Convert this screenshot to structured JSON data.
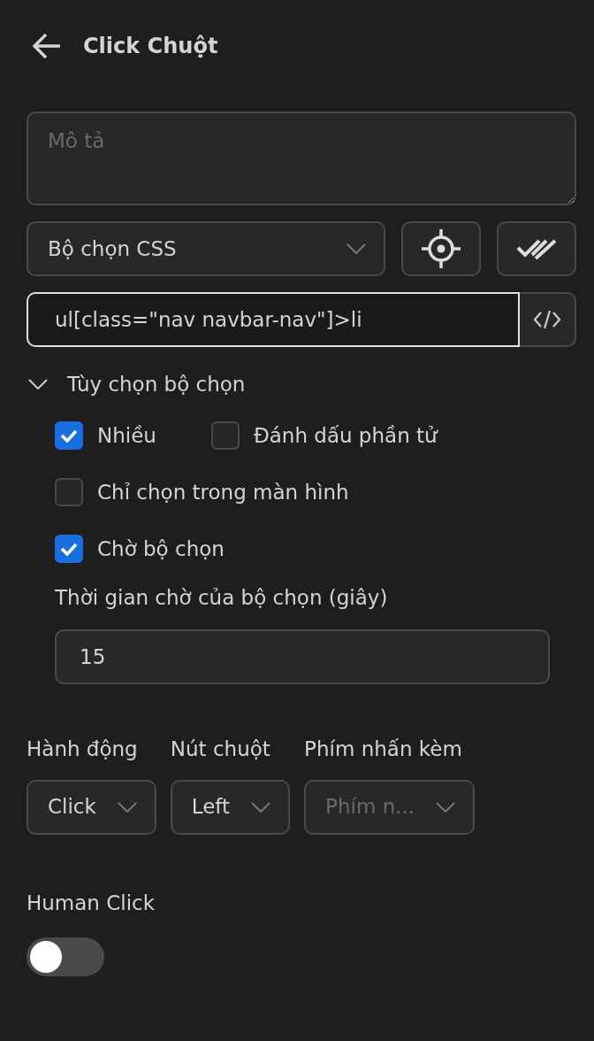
{
  "header": {
    "title": "Click Chuột"
  },
  "description": {
    "placeholder": "Mô tả"
  },
  "selector_type": {
    "value": "Bộ chọn CSS"
  },
  "selector": {
    "value": "ul[class=\"nav navbar-nav\"]>li"
  },
  "selector_options": {
    "label": "Tùy chọn bộ chọn",
    "expanded": true,
    "option_rows": [
      [
        {
          "label": "Nhiều",
          "checked": true
        },
        {
          "label": "Đánh dấu phần tử",
          "checked": false
        }
      ],
      [
        {
          "label": "Chỉ chọn trong màn hình",
          "checked": false
        }
      ],
      [
        {
          "label": "Chờ bộ chọn",
          "checked": true
        }
      ]
    ],
    "timeout": {
      "label": "Thời gian chờ của bộ chọn (giây)",
      "value": "15"
    }
  },
  "dropdowns": [
    {
      "label": "Hành động",
      "value": "Click"
    },
    {
      "label": "Nút chuột",
      "value": "Left"
    },
    {
      "label": "Phím nhấn kèm",
      "placeholder": "Phím n..."
    }
  ],
  "human_click": {
    "label": "Human Click",
    "on": false
  }
}
